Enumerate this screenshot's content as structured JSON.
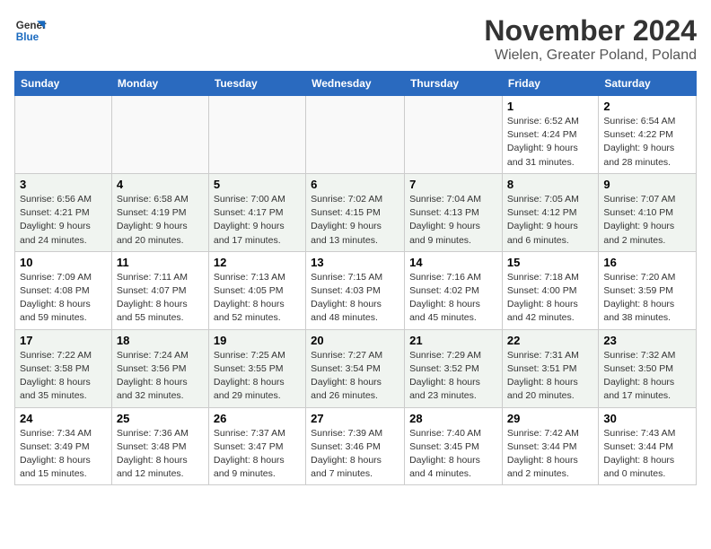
{
  "logo": {
    "line1": "General",
    "line2": "Blue"
  },
  "title": "November 2024",
  "location": "Wielen, Greater Poland, Poland",
  "weekdays": [
    "Sunday",
    "Monday",
    "Tuesday",
    "Wednesday",
    "Thursday",
    "Friday",
    "Saturday"
  ],
  "weeks": [
    [
      {
        "day": "",
        "info": ""
      },
      {
        "day": "",
        "info": ""
      },
      {
        "day": "",
        "info": ""
      },
      {
        "day": "",
        "info": ""
      },
      {
        "day": "",
        "info": ""
      },
      {
        "day": "1",
        "info": "Sunrise: 6:52 AM\nSunset: 4:24 PM\nDaylight: 9 hours\nand 31 minutes."
      },
      {
        "day": "2",
        "info": "Sunrise: 6:54 AM\nSunset: 4:22 PM\nDaylight: 9 hours\nand 28 minutes."
      }
    ],
    [
      {
        "day": "3",
        "info": "Sunrise: 6:56 AM\nSunset: 4:21 PM\nDaylight: 9 hours\nand 24 minutes."
      },
      {
        "day": "4",
        "info": "Sunrise: 6:58 AM\nSunset: 4:19 PM\nDaylight: 9 hours\nand 20 minutes."
      },
      {
        "day": "5",
        "info": "Sunrise: 7:00 AM\nSunset: 4:17 PM\nDaylight: 9 hours\nand 17 minutes."
      },
      {
        "day": "6",
        "info": "Sunrise: 7:02 AM\nSunset: 4:15 PM\nDaylight: 9 hours\nand 13 minutes."
      },
      {
        "day": "7",
        "info": "Sunrise: 7:04 AM\nSunset: 4:13 PM\nDaylight: 9 hours\nand 9 minutes."
      },
      {
        "day": "8",
        "info": "Sunrise: 7:05 AM\nSunset: 4:12 PM\nDaylight: 9 hours\nand 6 minutes."
      },
      {
        "day": "9",
        "info": "Sunrise: 7:07 AM\nSunset: 4:10 PM\nDaylight: 9 hours\nand 2 minutes."
      }
    ],
    [
      {
        "day": "10",
        "info": "Sunrise: 7:09 AM\nSunset: 4:08 PM\nDaylight: 8 hours\nand 59 minutes."
      },
      {
        "day": "11",
        "info": "Sunrise: 7:11 AM\nSunset: 4:07 PM\nDaylight: 8 hours\nand 55 minutes."
      },
      {
        "day": "12",
        "info": "Sunrise: 7:13 AM\nSunset: 4:05 PM\nDaylight: 8 hours\nand 52 minutes."
      },
      {
        "day": "13",
        "info": "Sunrise: 7:15 AM\nSunset: 4:03 PM\nDaylight: 8 hours\nand 48 minutes."
      },
      {
        "day": "14",
        "info": "Sunrise: 7:16 AM\nSunset: 4:02 PM\nDaylight: 8 hours\nand 45 minutes."
      },
      {
        "day": "15",
        "info": "Sunrise: 7:18 AM\nSunset: 4:00 PM\nDaylight: 8 hours\nand 42 minutes."
      },
      {
        "day": "16",
        "info": "Sunrise: 7:20 AM\nSunset: 3:59 PM\nDaylight: 8 hours\nand 38 minutes."
      }
    ],
    [
      {
        "day": "17",
        "info": "Sunrise: 7:22 AM\nSunset: 3:58 PM\nDaylight: 8 hours\nand 35 minutes."
      },
      {
        "day": "18",
        "info": "Sunrise: 7:24 AM\nSunset: 3:56 PM\nDaylight: 8 hours\nand 32 minutes."
      },
      {
        "day": "19",
        "info": "Sunrise: 7:25 AM\nSunset: 3:55 PM\nDaylight: 8 hours\nand 29 minutes."
      },
      {
        "day": "20",
        "info": "Sunrise: 7:27 AM\nSunset: 3:54 PM\nDaylight: 8 hours\nand 26 minutes."
      },
      {
        "day": "21",
        "info": "Sunrise: 7:29 AM\nSunset: 3:52 PM\nDaylight: 8 hours\nand 23 minutes."
      },
      {
        "day": "22",
        "info": "Sunrise: 7:31 AM\nSunset: 3:51 PM\nDaylight: 8 hours\nand 20 minutes."
      },
      {
        "day": "23",
        "info": "Sunrise: 7:32 AM\nSunset: 3:50 PM\nDaylight: 8 hours\nand 17 minutes."
      }
    ],
    [
      {
        "day": "24",
        "info": "Sunrise: 7:34 AM\nSunset: 3:49 PM\nDaylight: 8 hours\nand 15 minutes."
      },
      {
        "day": "25",
        "info": "Sunrise: 7:36 AM\nSunset: 3:48 PM\nDaylight: 8 hours\nand 12 minutes."
      },
      {
        "day": "26",
        "info": "Sunrise: 7:37 AM\nSunset: 3:47 PM\nDaylight: 8 hours\nand 9 minutes."
      },
      {
        "day": "27",
        "info": "Sunrise: 7:39 AM\nSunset: 3:46 PM\nDaylight: 8 hours\nand 7 minutes."
      },
      {
        "day": "28",
        "info": "Sunrise: 7:40 AM\nSunset: 3:45 PM\nDaylight: 8 hours\nand 4 minutes."
      },
      {
        "day": "29",
        "info": "Sunrise: 7:42 AM\nSunset: 3:44 PM\nDaylight: 8 hours\nand 2 minutes."
      },
      {
        "day": "30",
        "info": "Sunrise: 7:43 AM\nSunset: 3:44 PM\nDaylight: 8 hours\nand 0 minutes."
      }
    ]
  ]
}
